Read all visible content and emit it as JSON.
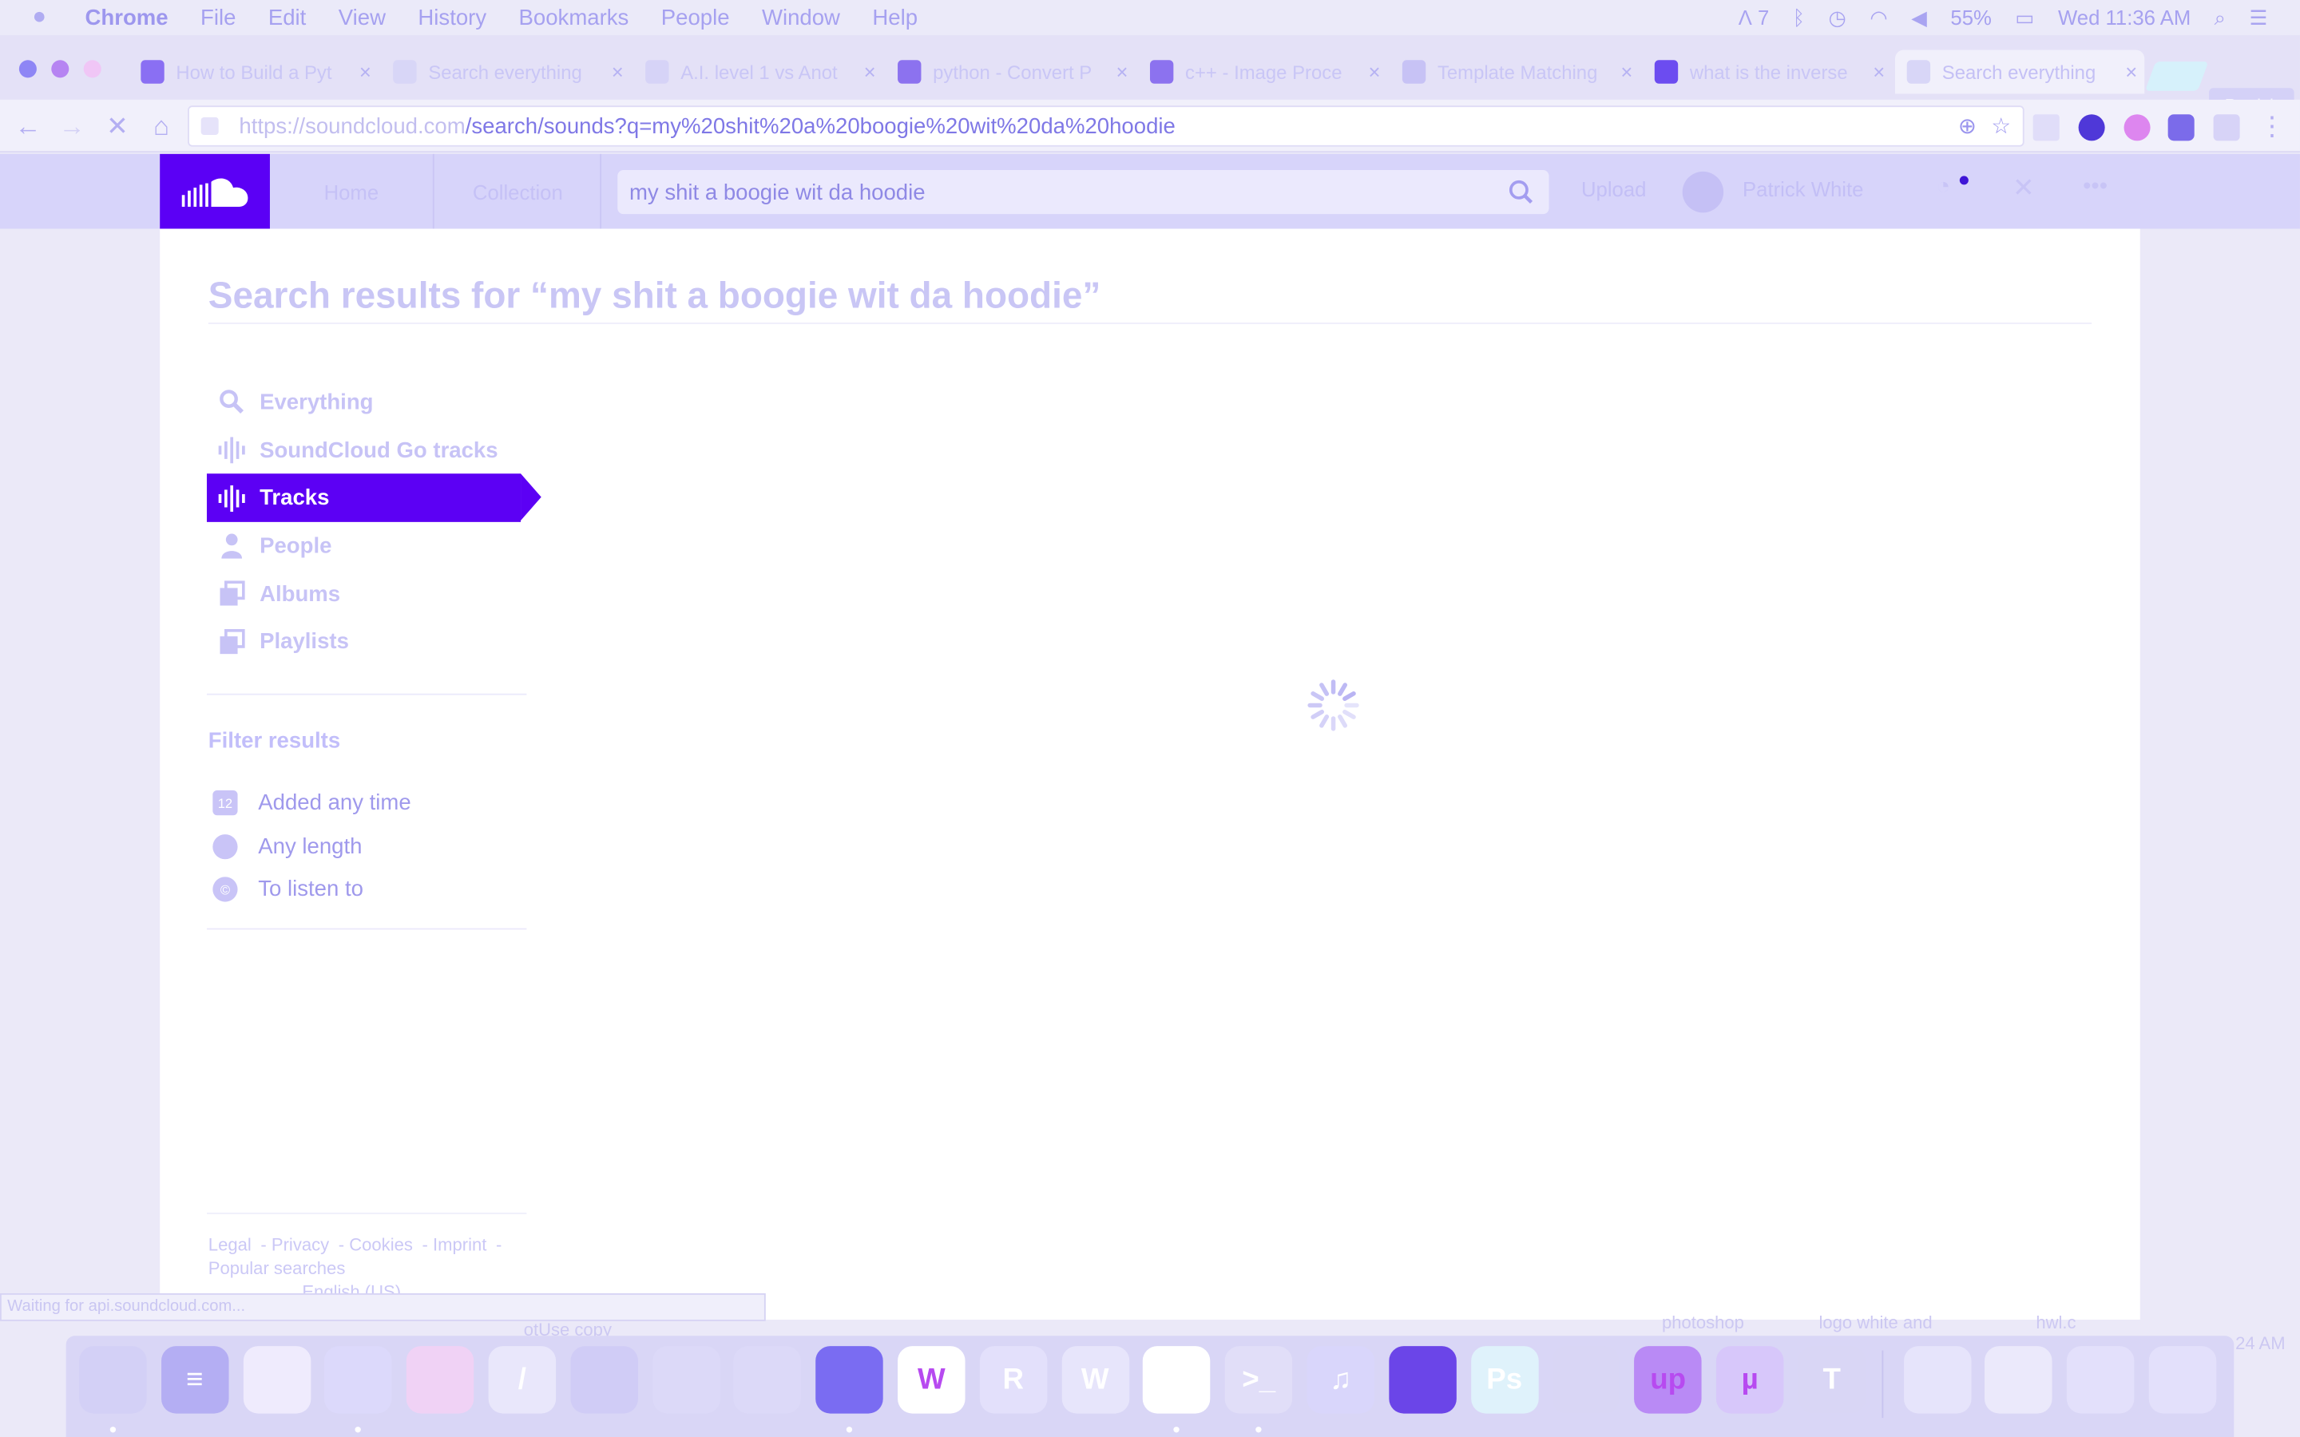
{
  "menubar": {
    "app": "Chrome",
    "items": [
      "File",
      "Edit",
      "View",
      "History",
      "Bookmarks",
      "People",
      "Window",
      "Help"
    ],
    "adobe_badge": "7",
    "battery": "55%",
    "clock": "Wed 11:36 AM"
  },
  "tabs": [
    {
      "title": "How to Build a Pyt",
      "icon": "plus-square-icon",
      "color": "#8a6ff3"
    },
    {
      "title": "Search everything",
      "icon": "loading-spinner-icon",
      "color": "#d8d6f7"
    },
    {
      "title": "A.I. level 1 vs Anot",
      "icon": "chess-knight-icon",
      "color": "#d6d3f7"
    },
    {
      "title": "python - Convert P",
      "icon": "stack-overflow-icon",
      "color": "#8c72ef"
    },
    {
      "title": "c++ - Image Proce",
      "icon": "stack-overflow-icon",
      "color": "#8c72ef"
    },
    {
      "title": "Template Matching",
      "icon": "document-icon",
      "color": "#c7c2f5"
    },
    {
      "title": "what is the inverse",
      "icon": "google-icon",
      "color": "#6c4cf0"
    },
    {
      "title": "Search everything",
      "icon": "loading-spinner-icon",
      "color": "#d8d6f7"
    }
  ],
  "profile_chip": "Patrick",
  "address": {
    "host": "https://soundcloud.com",
    "path": "/search/sounds?q=my%20shit%20a%20boogie%20wit%20da%20hoodie"
  },
  "soundcloud": {
    "nav": [
      "Home",
      "Collection"
    ],
    "search_value": "my shit a boogie wit da hoodie",
    "upload": "Upload",
    "user": "Patrick White"
  },
  "page": {
    "title": "Search results for “my shit a boogie wit da hoodie”",
    "nav": [
      {
        "label": "Everything",
        "icon": "search-icon",
        "active": false
      },
      {
        "label": "SoundCloud Go tracks",
        "icon": "waveform-icon",
        "active": false
      },
      {
        "label": "Tracks",
        "icon": "waveform-icon",
        "active": true
      },
      {
        "label": "People",
        "icon": "person-icon",
        "active": false
      },
      {
        "label": "Albums",
        "icon": "stack-icon",
        "active": false
      },
      {
        "label": "Playlists",
        "icon": "stack-icon",
        "active": false
      }
    ],
    "filter_title": "Filter results",
    "filters": [
      {
        "label": "Added any time",
        "icon": "calendar-icon"
      },
      {
        "label": "Any length",
        "icon": "clock-icon"
      },
      {
        "label": "To listen to",
        "icon": "copyright-icon"
      }
    ],
    "footer_links": [
      "Legal",
      "Privacy",
      "Cookies",
      "Imprint",
      "Popular searches"
    ],
    "language": "English (US)"
  },
  "status_bar": "Waiting for api.soundcloud.com...",
  "desktop_labels": [
    "otUse copy",
    "photoshop",
    "logo white and",
    "hwl.c",
    "24 AM"
  ],
  "dock": [
    {
      "name": "finder",
      "color": "#d3d0f6",
      "glyph": ""
    },
    {
      "name": "browser",
      "color": "#b4aef3",
      "glyph": "≡"
    },
    {
      "name": "notes",
      "color": "#efebfd",
      "glyph": ""
    },
    {
      "name": "messages",
      "color": "#dcd9fb",
      "glyph": ""
    },
    {
      "name": "ball",
      "color": "#f0d2f5",
      "glyph": ""
    },
    {
      "name": "script",
      "color": "#e9e7fb",
      "glyph": "/"
    },
    {
      "name": "preview",
      "color": "#d0ccf6",
      "glyph": ""
    },
    {
      "name": "xcode",
      "color": "#dcd9f8",
      "glyph": ""
    },
    {
      "name": "files",
      "color": "#dcd9f8",
      "glyph": ""
    },
    {
      "name": "chrome",
      "color": "#7a6cf2",
      "glyph": ""
    },
    {
      "name": "webstorm",
      "color": "#ffffff",
      "glyph": "W"
    },
    {
      "name": "rstudio",
      "color": "#e3e0fb",
      "glyph": "R"
    },
    {
      "name": "word",
      "color": "#e7e5fb",
      "glyph": "W"
    },
    {
      "name": "phpstorm",
      "color": "#ffffff",
      "glyph": ""
    },
    {
      "name": "terminal",
      "color": "#e1def8",
      "glyph": ">_"
    },
    {
      "name": "itunes",
      "color": "#d9d6fb",
      "glyph": "♫"
    },
    {
      "name": "ibooks",
      "color": "#6b45e8",
      "glyph": ""
    },
    {
      "name": "photoshop",
      "color": "#dff2fb",
      "glyph": "Ps"
    },
    {
      "name": "disk-utility",
      "color": "#d9d6f5",
      "glyph": ""
    },
    {
      "name": "upwork",
      "color": "#b98af5",
      "glyph": "up"
    },
    {
      "name": "utorrent",
      "color": "#d7c7fa",
      "glyph": "µ"
    },
    {
      "name": "typora",
      "color": "#d9d6f5",
      "glyph": "T"
    },
    {
      "name": "folder",
      "color": "#e6e4fb",
      "glyph": ""
    },
    {
      "name": "downloads",
      "color": "#ebe9fb",
      "glyph": ""
    },
    {
      "name": "stack",
      "color": "#e3e0fb",
      "glyph": ""
    },
    {
      "name": "trash",
      "color": "#e3e0fb",
      "glyph": ""
    }
  ]
}
